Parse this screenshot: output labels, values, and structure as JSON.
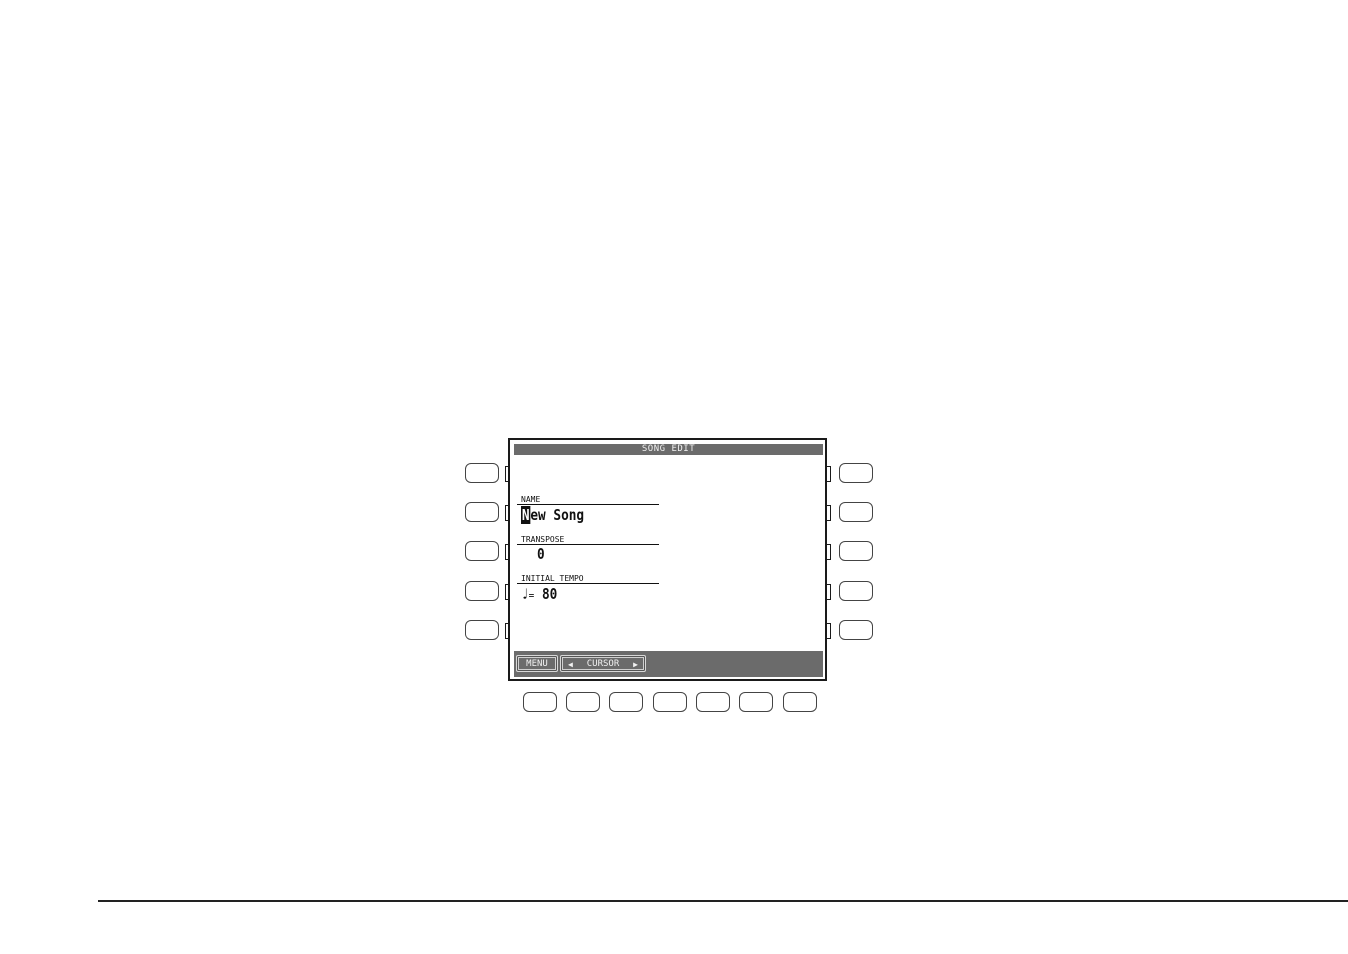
{
  "screen": {
    "title": "SONG EDIT",
    "fields": [
      {
        "label": "NAME",
        "value_cursor_char": "N",
        "value_rest": "ew Song"
      },
      {
        "label": "TRANSPOSE",
        "value": "0"
      },
      {
        "label": "INITIAL TEMPO",
        "note_symbol": "♩",
        "equals": "=",
        "value": "80"
      }
    ],
    "footer": {
      "menu_label": "MENU",
      "cursor_label": "CURSOR",
      "left_arrow": "◀",
      "right_arrow": "▶"
    }
  },
  "hardware": {
    "left_buttons": 5,
    "right_buttons": 5,
    "bottom_buttons": 7
  },
  "colors": {
    "lcd_bar": "#6b6b6b",
    "lcd_text": "#111111",
    "frame": "#1a1a1a"
  }
}
